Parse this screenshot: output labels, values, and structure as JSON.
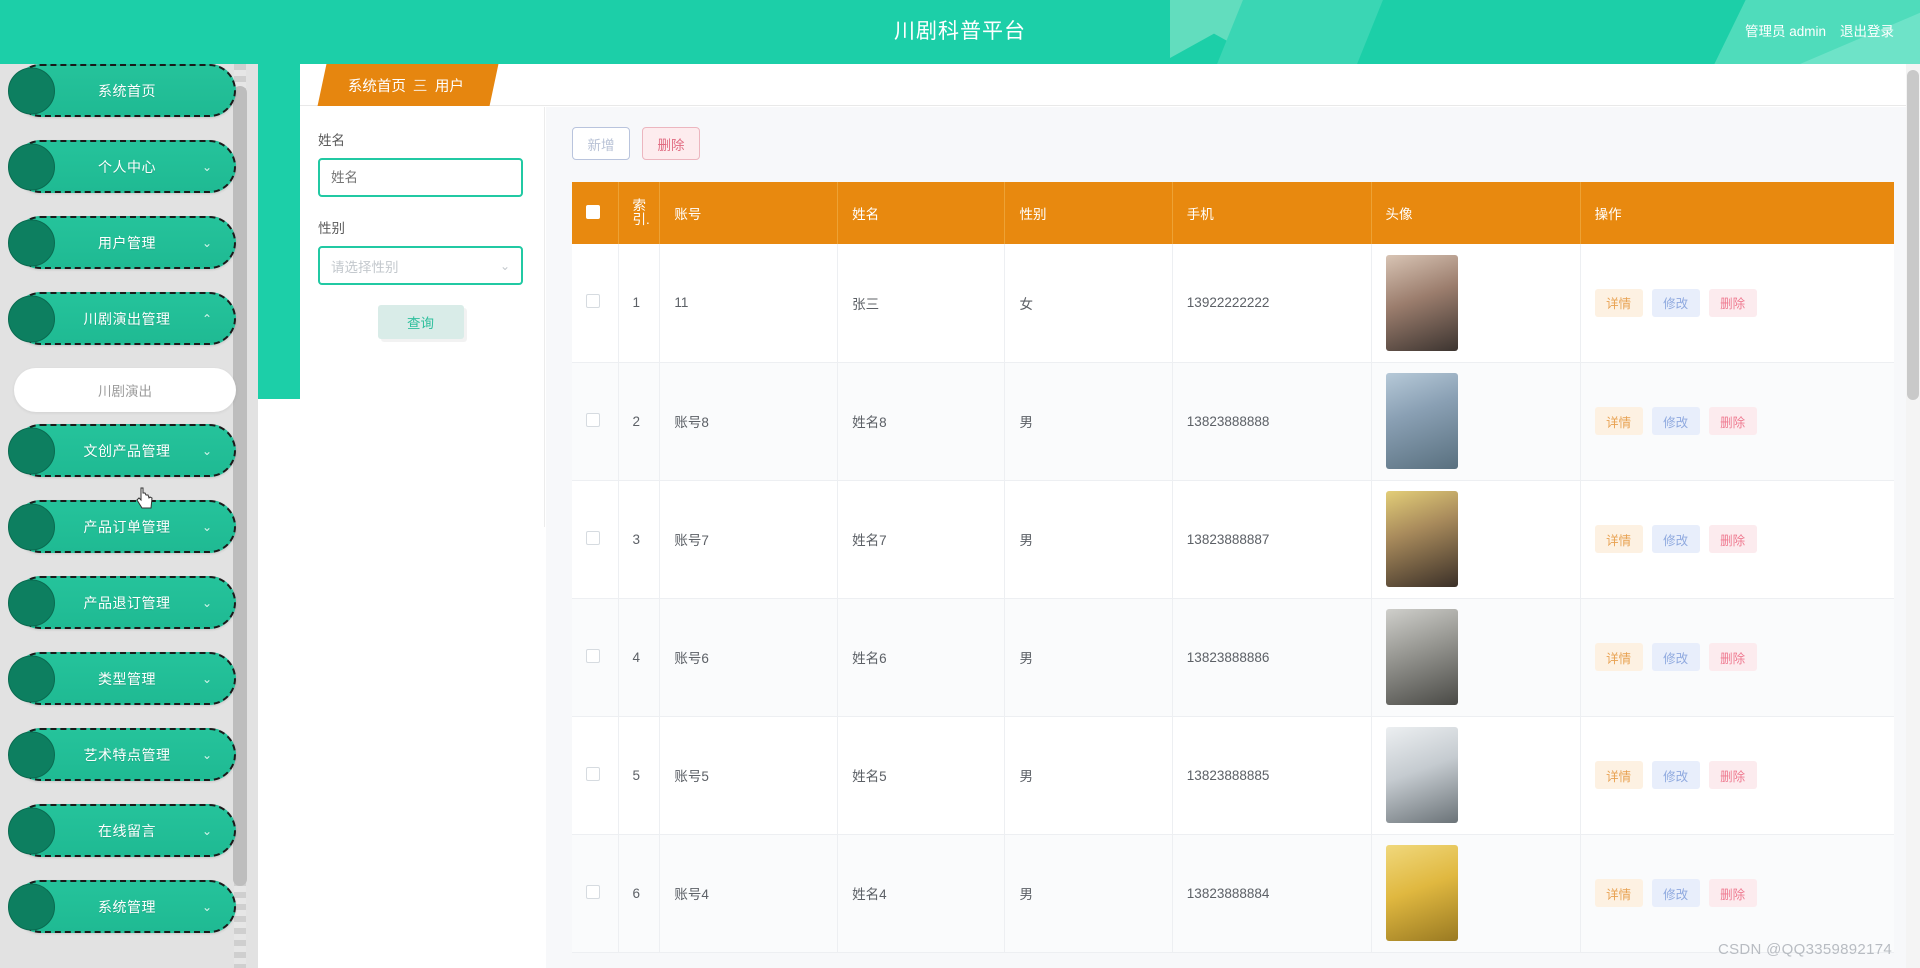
{
  "header": {
    "title": "川剧科普平台",
    "admin_label": "管理员 admin",
    "logout_label": "退出登录"
  },
  "sidebar": {
    "items": [
      {
        "label": "系统首页",
        "caret": ""
      },
      {
        "label": "个人中心",
        "caret": "⌄"
      },
      {
        "label": "用户管理",
        "caret": "⌄"
      },
      {
        "label": "川剧演出管理",
        "caret": "⌃"
      },
      {
        "label": "文创产品管理",
        "caret": "⌄"
      },
      {
        "label": "产品订单管理",
        "caret": "⌄"
      },
      {
        "label": "产品退订管理",
        "caret": "⌄"
      },
      {
        "label": "类型管理",
        "caret": "⌄"
      },
      {
        "label": "艺术特点管理",
        "caret": "⌄"
      },
      {
        "label": "在线留言",
        "caret": "⌄"
      },
      {
        "label": "系统管理",
        "caret": "⌄"
      }
    ],
    "submenu": {
      "label": "川剧演出"
    }
  },
  "tab": {
    "home_label": "系统首页",
    "separator": "三",
    "current_label": "用户"
  },
  "filter": {
    "name_label": "姓名",
    "name_placeholder": "姓名",
    "name_value": "",
    "gender_label": "性别",
    "gender_placeholder": "请选择性别",
    "gender_value": "",
    "gender_caret": "⌄",
    "search_label": "查询"
  },
  "toolbar": {
    "add_label": "新增",
    "delete_label": "删除"
  },
  "table": {
    "columns": [
      "",
      "索引",
      "账号",
      "姓名",
      "性别",
      "手机",
      "头像",
      "操作"
    ],
    "header_index_line1": "索",
    "header_index_line2": "引.",
    "rows": [
      {
        "index": "1",
        "account": "11",
        "name": "张三",
        "gender": "女",
        "phone": "13922222222",
        "avatar_tone": "#cbb6a8"
      },
      {
        "index": "2",
        "account": "账号8",
        "name": "姓名8",
        "gender": "男",
        "phone": "13823888888",
        "avatar_tone": "#8fa7bd"
      },
      {
        "index": "3",
        "account": "账号7",
        "name": "姓名7",
        "gender": "男",
        "phone": "13823888887",
        "avatar_tone": "#e0c96a"
      },
      {
        "index": "4",
        "account": "账号6",
        "name": "姓名6",
        "gender": "男",
        "phone": "13823888886",
        "avatar_tone": "#b3b3ae"
      },
      {
        "index": "5",
        "account": "账号5",
        "name": "姓名5",
        "gender": "男",
        "phone": "13823888885",
        "avatar_tone": "#c6c6c6"
      },
      {
        "index": "6",
        "account": "账号4",
        "name": "姓名4",
        "gender": "男",
        "phone": "13823888884",
        "avatar_tone": "#e8c657"
      }
    ],
    "ops": {
      "detail": "详情",
      "edit": "修改",
      "delete": "删除"
    }
  },
  "watermark": "CSDN @QQ3359892174",
  "colors": {
    "brand_green": "#1ccfa8",
    "menu_green": "#22c29a",
    "accent_orange": "#e8890f",
    "tab_orange": "#e6860f"
  }
}
